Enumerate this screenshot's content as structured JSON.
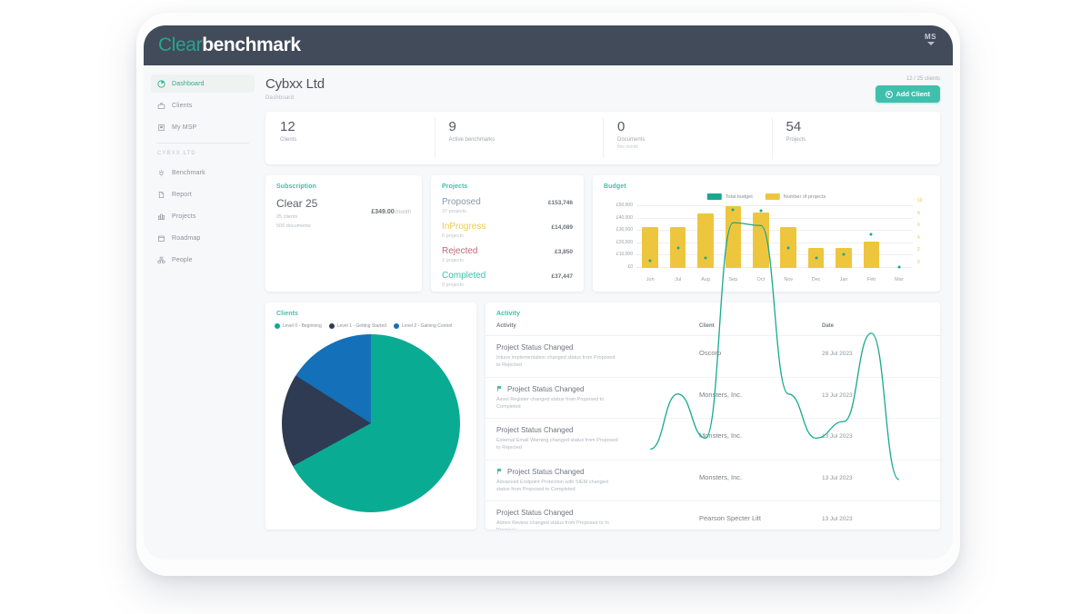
{
  "brand": {
    "part1": "Clear",
    "part2": "benchmark"
  },
  "user": {
    "initials": "MS"
  },
  "sidebar": {
    "primary": [
      {
        "label": "Dashboard",
        "icon": "pie-chart-icon",
        "active": true
      },
      {
        "label": "Clients",
        "icon": "briefcase-icon",
        "active": false
      },
      {
        "label": "My MSP",
        "icon": "building-icon",
        "active": false
      }
    ],
    "section_title": "CYBXX LTD",
    "secondary": [
      {
        "label": "Benchmark",
        "icon": "target-icon"
      },
      {
        "label": "Report",
        "icon": "document-icon"
      },
      {
        "label": "Projects",
        "icon": "chart-bars-icon"
      },
      {
        "label": "Roadmap",
        "icon": "calendar-icon"
      },
      {
        "label": "People",
        "icon": "people-icon"
      }
    ]
  },
  "header": {
    "title": "Cybxx Ltd",
    "breadcrumb": "Dashboard",
    "client_count": "12 / 25 clients",
    "add_client_label": "Add Client"
  },
  "stats": [
    {
      "value": "12",
      "label": "Clients",
      "sub": ""
    },
    {
      "value": "9",
      "label": "Active benchmarks",
      "sub": ""
    },
    {
      "value": "0",
      "label": "Documents",
      "sub": "this month"
    },
    {
      "value": "54",
      "label": "Projects",
      "sub": ""
    }
  ],
  "subscription": {
    "title": "Subscription",
    "plan_name": "Clear 25",
    "limit_clients": "25 clients",
    "limit_documents": "500 documents",
    "price": "£349.00",
    "period": "/month"
  },
  "projects": {
    "title": "Projects",
    "rows": [
      {
        "name": "Proposed",
        "count": "37 projects",
        "amount": "£153,746",
        "color": "#8b99a8"
      },
      {
        "name": "InProgress",
        "count": "6 projects",
        "amount": "£14,089",
        "color": "#efc94c"
      },
      {
        "name": "Rejected",
        "count": "2 projects",
        "amount": "£3,850",
        "color": "#c4687b"
      },
      {
        "name": "Completed",
        "count": "9 projects",
        "amount": "£37,447",
        "color": "#3fc0ac"
      }
    ]
  },
  "budget": {
    "title": "Budget"
  },
  "clients_chart": {
    "title": "Clients",
    "legend": [
      {
        "label": "Level 0 - Beginning",
        "color": "#0aab93"
      },
      {
        "label": "Level 1 - Getting Started",
        "color": "#2f3b52"
      },
      {
        "label": "Level 2 - Gaining Control",
        "color": "#1470b8"
      }
    ]
  },
  "activity": {
    "title": "Activity",
    "columns": [
      "Activity",
      "Client",
      "Date"
    ],
    "rows": [
      {
        "title": "Project Status Changed",
        "has_icon": false,
        "desc": "Intune implementation changed status from Proposed to Rejected",
        "client": "Oscorp",
        "date": "28 Jul 2023"
      },
      {
        "title": "Project Status Changed",
        "has_icon": true,
        "desc": "Asset Register changed status from Proposed to Completed",
        "client": "Monsters, Inc.",
        "date": "13 Jul 2023"
      },
      {
        "title": "Project Status Changed",
        "has_icon": false,
        "desc": "External Email Warning changed status from Proposed to Rejected",
        "client": "Monsters, Inc.",
        "date": "13 Jul 2023"
      },
      {
        "title": "Project Status Changed",
        "has_icon": true,
        "desc": "Advanced Endpoint Protection with SIEM changed status from Proposed to Completed",
        "client": "Monsters, Inc.",
        "date": "13 Jul 2023"
      },
      {
        "title": "Project Status Changed",
        "has_icon": false,
        "desc": "Admin Review changed status from Proposed to In Progress",
        "client": "Pearson Specter Litt",
        "date": "13 Jul 2023"
      }
    ]
  },
  "chart_data": [
    {
      "type": "bar",
      "title": "Budget",
      "xlabel": "",
      "ylabel": "",
      "categories": [
        "Jun",
        "Jul",
        "Aug",
        "Sep",
        "Oct",
        "Nov",
        "Dec",
        "Jan",
        "Feb",
        "Mar"
      ],
      "ylim": [
        0,
        50000
      ],
      "yticks": [
        "£0",
        "£10,000",
        "£20,000",
        "£30,000",
        "£40,000",
        "£50,000"
      ],
      "y2lim": [
        0,
        10
      ],
      "y2ticks": [
        "0",
        "2",
        "4",
        "6",
        "8",
        "10"
      ],
      "grid": true,
      "legend_position": "top-center",
      "series": [
        {
          "name": "Number of projects",
          "type": "bar",
          "color": "#eec63e",
          "axis": "left",
          "values": [
            33000,
            33000,
            44000,
            50000,
            45000,
            33000,
            16000,
            16000,
            21000,
            0
          ]
        },
        {
          "name": "Total budget",
          "type": "line",
          "color": "#17a98f",
          "axis": "right",
          "values": [
            1.2,
            3.2,
            1.6,
            9.4,
            9.3,
            3.2,
            1.6,
            2.2,
            5.4,
            0.1
          ]
        }
      ]
    },
    {
      "type": "pie",
      "title": "Clients",
      "legend_position": "top",
      "labels": [
        "Level 0 - Beginning",
        "Level 1 - Getting Started",
        "Level 2 - Gaining Control"
      ],
      "values": [
        67,
        17,
        16
      ],
      "colors": [
        "#0aab93",
        "#2f3b52",
        "#1470b8"
      ]
    }
  ]
}
